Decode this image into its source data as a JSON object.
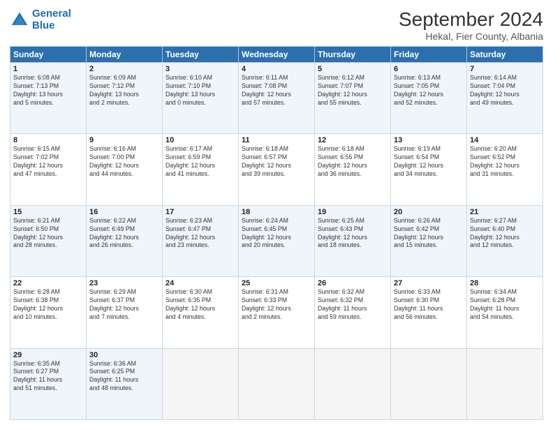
{
  "header": {
    "logo_line1": "General",
    "logo_line2": "Blue",
    "month": "September 2024",
    "location": "Hekal, Fier County, Albania"
  },
  "weekdays": [
    "Sunday",
    "Monday",
    "Tuesday",
    "Wednesday",
    "Thursday",
    "Friday",
    "Saturday"
  ],
  "weeks": [
    [
      {
        "day": "1",
        "info": "Sunrise: 6:08 AM\nSunset: 7:13 PM\nDaylight: 13 hours\nand 5 minutes."
      },
      {
        "day": "2",
        "info": "Sunrise: 6:09 AM\nSunset: 7:12 PM\nDaylight: 13 hours\nand 2 minutes."
      },
      {
        "day": "3",
        "info": "Sunrise: 6:10 AM\nSunset: 7:10 PM\nDaylight: 13 hours\nand 0 minutes."
      },
      {
        "day": "4",
        "info": "Sunrise: 6:11 AM\nSunset: 7:08 PM\nDaylight: 12 hours\nand 57 minutes."
      },
      {
        "day": "5",
        "info": "Sunrise: 6:12 AM\nSunset: 7:07 PM\nDaylight: 12 hours\nand 55 minutes."
      },
      {
        "day": "6",
        "info": "Sunrise: 6:13 AM\nSunset: 7:05 PM\nDaylight: 12 hours\nand 52 minutes."
      },
      {
        "day": "7",
        "info": "Sunrise: 6:14 AM\nSunset: 7:04 PM\nDaylight: 12 hours\nand 49 minutes."
      }
    ],
    [
      {
        "day": "8",
        "info": "Sunrise: 6:15 AM\nSunset: 7:02 PM\nDaylight: 12 hours\nand 47 minutes."
      },
      {
        "day": "9",
        "info": "Sunrise: 6:16 AM\nSunset: 7:00 PM\nDaylight: 12 hours\nand 44 minutes."
      },
      {
        "day": "10",
        "info": "Sunrise: 6:17 AM\nSunset: 6:59 PM\nDaylight: 12 hours\nand 41 minutes."
      },
      {
        "day": "11",
        "info": "Sunrise: 6:18 AM\nSunset: 6:57 PM\nDaylight: 12 hours\nand 39 minutes."
      },
      {
        "day": "12",
        "info": "Sunrise: 6:18 AM\nSunset: 6:55 PM\nDaylight: 12 hours\nand 36 minutes."
      },
      {
        "day": "13",
        "info": "Sunrise: 6:19 AM\nSunset: 6:54 PM\nDaylight: 12 hours\nand 34 minutes."
      },
      {
        "day": "14",
        "info": "Sunrise: 6:20 AM\nSunset: 6:52 PM\nDaylight: 12 hours\nand 31 minutes."
      }
    ],
    [
      {
        "day": "15",
        "info": "Sunrise: 6:21 AM\nSunset: 6:50 PM\nDaylight: 12 hours\nand 28 minutes."
      },
      {
        "day": "16",
        "info": "Sunrise: 6:22 AM\nSunset: 6:49 PM\nDaylight: 12 hours\nand 26 minutes."
      },
      {
        "day": "17",
        "info": "Sunrise: 6:23 AM\nSunset: 6:47 PM\nDaylight: 12 hours\nand 23 minutes."
      },
      {
        "day": "18",
        "info": "Sunrise: 6:24 AM\nSunset: 6:45 PM\nDaylight: 12 hours\nand 20 minutes."
      },
      {
        "day": "19",
        "info": "Sunrise: 6:25 AM\nSunset: 6:43 PM\nDaylight: 12 hours\nand 18 minutes."
      },
      {
        "day": "20",
        "info": "Sunrise: 6:26 AM\nSunset: 6:42 PM\nDaylight: 12 hours\nand 15 minutes."
      },
      {
        "day": "21",
        "info": "Sunrise: 6:27 AM\nSunset: 6:40 PM\nDaylight: 12 hours\nand 12 minutes."
      }
    ],
    [
      {
        "day": "22",
        "info": "Sunrise: 6:28 AM\nSunset: 6:38 PM\nDaylight: 12 hours\nand 10 minutes."
      },
      {
        "day": "23",
        "info": "Sunrise: 6:29 AM\nSunset: 6:37 PM\nDaylight: 12 hours\nand 7 minutes."
      },
      {
        "day": "24",
        "info": "Sunrise: 6:30 AM\nSunset: 6:35 PM\nDaylight: 12 hours\nand 4 minutes."
      },
      {
        "day": "25",
        "info": "Sunrise: 6:31 AM\nSunset: 6:33 PM\nDaylight: 12 hours\nand 2 minutes."
      },
      {
        "day": "26",
        "info": "Sunrise: 6:32 AM\nSunset: 6:32 PM\nDaylight: 11 hours\nand 59 minutes."
      },
      {
        "day": "27",
        "info": "Sunrise: 6:33 AM\nSunset: 6:30 PM\nDaylight: 11 hours\nand 56 minutes."
      },
      {
        "day": "28",
        "info": "Sunrise: 6:34 AM\nSunset: 6:28 PM\nDaylight: 11 hours\nand 54 minutes."
      }
    ],
    [
      {
        "day": "29",
        "info": "Sunrise: 6:35 AM\nSunset: 6:27 PM\nDaylight: 11 hours\nand 51 minutes."
      },
      {
        "day": "30",
        "info": "Sunrise: 6:36 AM\nSunset: 6:25 PM\nDaylight: 11 hours\nand 48 minutes."
      },
      {
        "day": "",
        "info": ""
      },
      {
        "day": "",
        "info": ""
      },
      {
        "day": "",
        "info": ""
      },
      {
        "day": "",
        "info": ""
      },
      {
        "day": "",
        "info": ""
      }
    ]
  ]
}
